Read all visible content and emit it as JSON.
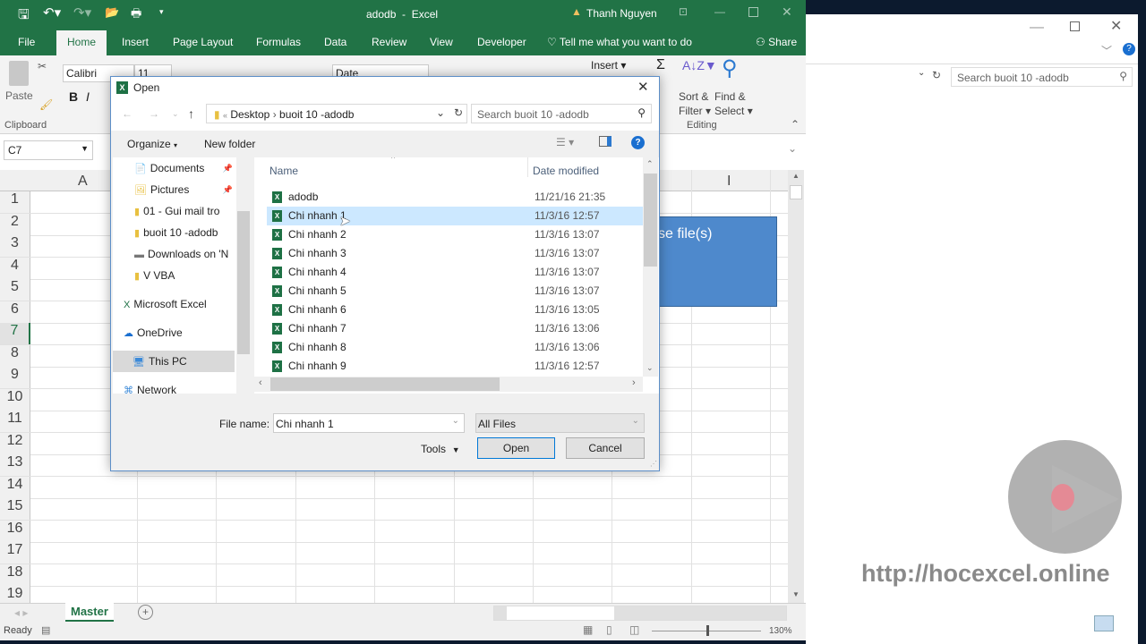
{
  "app": {
    "title": "adodb",
    "app_name": "Excel",
    "user": "Thanh Nguyen",
    "accent": "#217346"
  },
  "ribbon_tabs": [
    "File",
    "Home",
    "Insert",
    "Page Layout",
    "Formulas",
    "Data",
    "Review",
    "View",
    "Developer"
  ],
  "tell_me": "Tell me what you want to do",
  "share": "Share",
  "ribbon": {
    "paste": "Paste",
    "font": "Calibri",
    "font_size": "11",
    "number_format": "Date",
    "insert": "Insert",
    "sort_filter_1": "Sort &",
    "sort_filter_2": "Filter",
    "find_select_1": "Find &",
    "find_select_2": "Select",
    "clipboard": "Clipboard",
    "editing": "Editing"
  },
  "name_box": "C7",
  "columns": {
    "a": "A",
    "i": "I"
  },
  "rows": [
    "1",
    "2",
    "3",
    "4",
    "5",
    "6",
    "7",
    "8",
    "9",
    "10",
    "11",
    "12",
    "13",
    "14",
    "15",
    "16",
    "17",
    "18",
    "19"
  ],
  "shape_text": "se file(s)",
  "sheet_tab": "Master",
  "status": {
    "ready": "Ready",
    "zoom": "130%"
  },
  "dialog": {
    "title": "Open",
    "breadcrumb": [
      "Desktop",
      "buoit 10 -adodb"
    ],
    "search_placeholder": "Search buoit 10 -adodb",
    "organize": "Organize",
    "new_folder": "New folder",
    "nav_items": [
      "Documents",
      "Pictures",
      "01 - Gui mail tro",
      "buoit 10 -adodb",
      "Downloads on 'N",
      "V VBA",
      "Microsoft Excel",
      "OneDrive",
      "This PC",
      "Network"
    ],
    "col_name": "Name",
    "col_date": "Date modified",
    "files": [
      {
        "name": "adodb",
        "date": "11/21/16 21:35"
      },
      {
        "name": "Chi nhanh 1",
        "date": "11/3/16 12:57",
        "selected": true
      },
      {
        "name": "Chi nhanh 2",
        "date": "11/3/16 13:07"
      },
      {
        "name": "Chi nhanh 3",
        "date": "11/3/16 13:07"
      },
      {
        "name": "Chi nhanh 4",
        "date": "11/3/16 13:07"
      },
      {
        "name": "Chi nhanh 5",
        "date": "11/3/16 13:07"
      },
      {
        "name": "Chi nhanh 6",
        "date": "11/3/16 13:05"
      },
      {
        "name": "Chi nhanh 7",
        "date": "11/3/16 13:06"
      },
      {
        "name": "Chi nhanh 8",
        "date": "11/3/16 13:06"
      },
      {
        "name": "Chi nhanh 9",
        "date": "11/3/16 12:57"
      }
    ],
    "file_name_label": "File name:",
    "file_name_value": "Chi nhanh 1",
    "file_type": "All Files",
    "tools": "Tools",
    "open": "Open",
    "cancel": "Cancel"
  },
  "explorer_bg": {
    "search_placeholder": "Search buoit 10 -adodb"
  },
  "watermark": "http://hocexcel.online"
}
